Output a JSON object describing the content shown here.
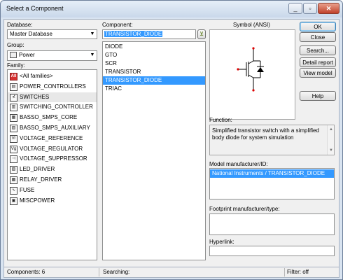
{
  "window": {
    "title": "Select a Component"
  },
  "database": {
    "label": "Database:",
    "value": "Master Database"
  },
  "group": {
    "label": "Group:",
    "value": "Power"
  },
  "family": {
    "label": "Family:",
    "items": [
      {
        "label": "<All families>",
        "icon": "all-icon",
        "glyph": "All"
      },
      {
        "label": "POWER_CONTROLLERS",
        "icon": "power-controller-icon",
        "glyph": "▤"
      },
      {
        "label": "SWITCHES",
        "icon": "switch-icon",
        "glyph": "⊀"
      },
      {
        "label": "SWITCHING_CONTROLLER",
        "icon": "switching-controller-icon",
        "glyph": "▥"
      },
      {
        "label": "BASSO_SMPS_CORE",
        "icon": "smps-core-icon",
        "glyph": "▦"
      },
      {
        "label": "BASSO_SMPS_AUXILIARY",
        "icon": "smps-aux-icon",
        "glyph": "▧"
      },
      {
        "label": "VOLTAGE_REFERENCE",
        "icon": "voltage-reference-icon",
        "glyph": "Vr"
      },
      {
        "label": "VOLTAGE_REGULATOR",
        "icon": "voltage-regulator-icon",
        "glyph": "Vg"
      },
      {
        "label": "VOLTAGE_SUPPRESSOR",
        "icon": "voltage-suppressor-icon",
        "glyph": "⊣"
      },
      {
        "label": "LED_DRIVER",
        "icon": "led-driver-icon",
        "glyph": "▨"
      },
      {
        "label": "RELAY_DRIVER",
        "icon": "relay-driver-icon",
        "glyph": "▩"
      },
      {
        "label": "FUSE",
        "icon": "fuse-icon",
        "glyph": "∿"
      },
      {
        "label": "MISCPOWER",
        "icon": "misc-power-icon",
        "glyph": "▣"
      }
    ]
  },
  "component": {
    "label": "Component:",
    "search_value": "TRANSISTOR_DIODE",
    "items": [
      "DIODE",
      "GTO",
      "SCR",
      "TRANSISTOR",
      "TRANSISTOR_DIODE",
      "TRIAC"
    ],
    "selected_index": 4
  },
  "symbol": {
    "label": "Symbol (ANSI)"
  },
  "buttons": {
    "ok": "OK",
    "close": "Close",
    "search": "Search...",
    "detail_report": "Detail report",
    "view_model": "View model",
    "help": "Help"
  },
  "function": {
    "label": "Function:",
    "text": "Simplified transistor switch with a simplified body diode for system simulation"
  },
  "model": {
    "label": "Model manufacturer/ID:",
    "items": [
      "National Instruments / TRANSISTOR_DIODE"
    ]
  },
  "footprint": {
    "label": "Footprint manufacturer/type:"
  },
  "hyperlink": {
    "label": "Hyperlink:",
    "value": ""
  },
  "status": {
    "components": "Components: 6",
    "searching": "Searching:",
    "filter": "Filter: off"
  },
  "colors": {
    "selection": "#3399ff",
    "family_all_icon": "#d62f2f"
  }
}
